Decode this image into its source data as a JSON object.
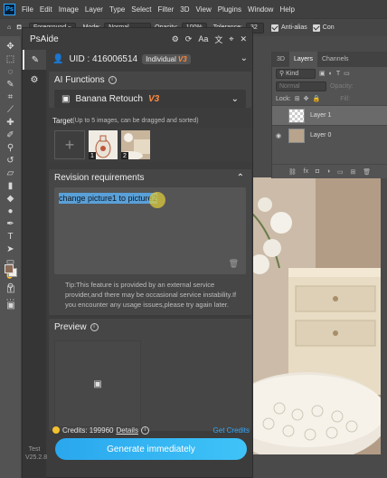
{
  "menubar": {
    "items": [
      "File",
      "Edit",
      "Image",
      "Layer",
      "Type",
      "Select",
      "Filter",
      "3D",
      "View",
      "Plugins",
      "Window",
      "Help"
    ]
  },
  "options": {
    "foreground": "Foreground",
    "mode_label": "Mode:",
    "mode_value": "Normal",
    "opacity_label": "Opacity:",
    "opacity_value": "100%",
    "tolerance_label": "Tolerance:",
    "tolerance_value": "32",
    "antialias": "Anti-alias",
    "contiguous": "Con"
  },
  "layers_panel": {
    "tabs": [
      "3D",
      "Layers",
      "Channels"
    ],
    "kind": "Kind",
    "blend": "Normal",
    "opacity_label": "Opacity:",
    "lock_label": "Lock:",
    "fill_label": "Fill:",
    "layers": [
      {
        "name": "Layer 1"
      },
      {
        "name": "Layer 0"
      }
    ]
  },
  "plugin": {
    "title": "PsAide",
    "uid": "UID : 416006514",
    "plan": "Individual",
    "plan_tag": "V3",
    "ai_functions": {
      "title": "AI Functions",
      "selected": "Banana Retouch",
      "selected_tag": "V3"
    },
    "target": {
      "title": "Target",
      "hint": "(Up to 5 images, can be dragged and sorted)",
      "thumbs": [
        {
          "num": "1"
        },
        {
          "num": "2"
        }
      ]
    },
    "revision": {
      "title": "Revision requirements",
      "text": "change picture1 to picture2"
    },
    "tip": "Tip:This feature is provided by an external service provider,and there may be occasional service instability.If you encounter any usage issues,please try again later.",
    "preview": {
      "title": "Preview"
    },
    "credits": {
      "label": "Credits: 199960",
      "details": "Details",
      "get": "Get Credits"
    },
    "generate": "Generate immediately"
  },
  "version": {
    "name": "Test",
    "num": "V25.2.8"
  },
  "colors": {
    "accent": "#31a8ff",
    "button": "#2aa7ee",
    "coin": "#f2c12e"
  }
}
